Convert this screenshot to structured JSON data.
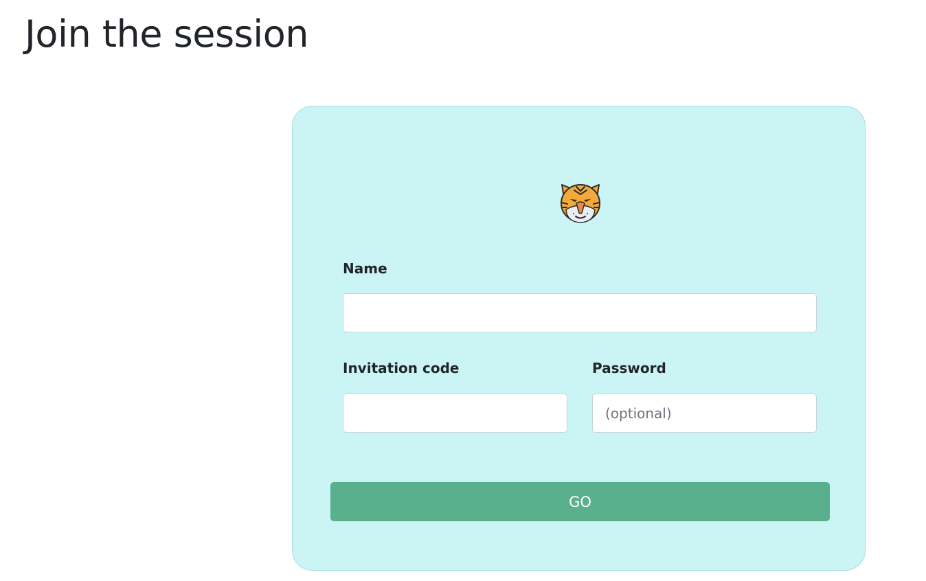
{
  "page": {
    "title": "Join the session"
  },
  "form": {
    "avatar_icon": "tiger-face-icon",
    "name_label": "Name",
    "name_value": "",
    "name_placeholder": "",
    "invitation_label": "Invitation code",
    "invitation_value": "",
    "invitation_placeholder": "",
    "password_label": "Password",
    "password_value": "",
    "password_placeholder": "(optional)",
    "submit_label": "GO"
  },
  "colors": {
    "card_background": "#cbf5f4",
    "card_border": "#a9dcdc",
    "button_background": "#5aaf8d",
    "text": "#212529"
  }
}
